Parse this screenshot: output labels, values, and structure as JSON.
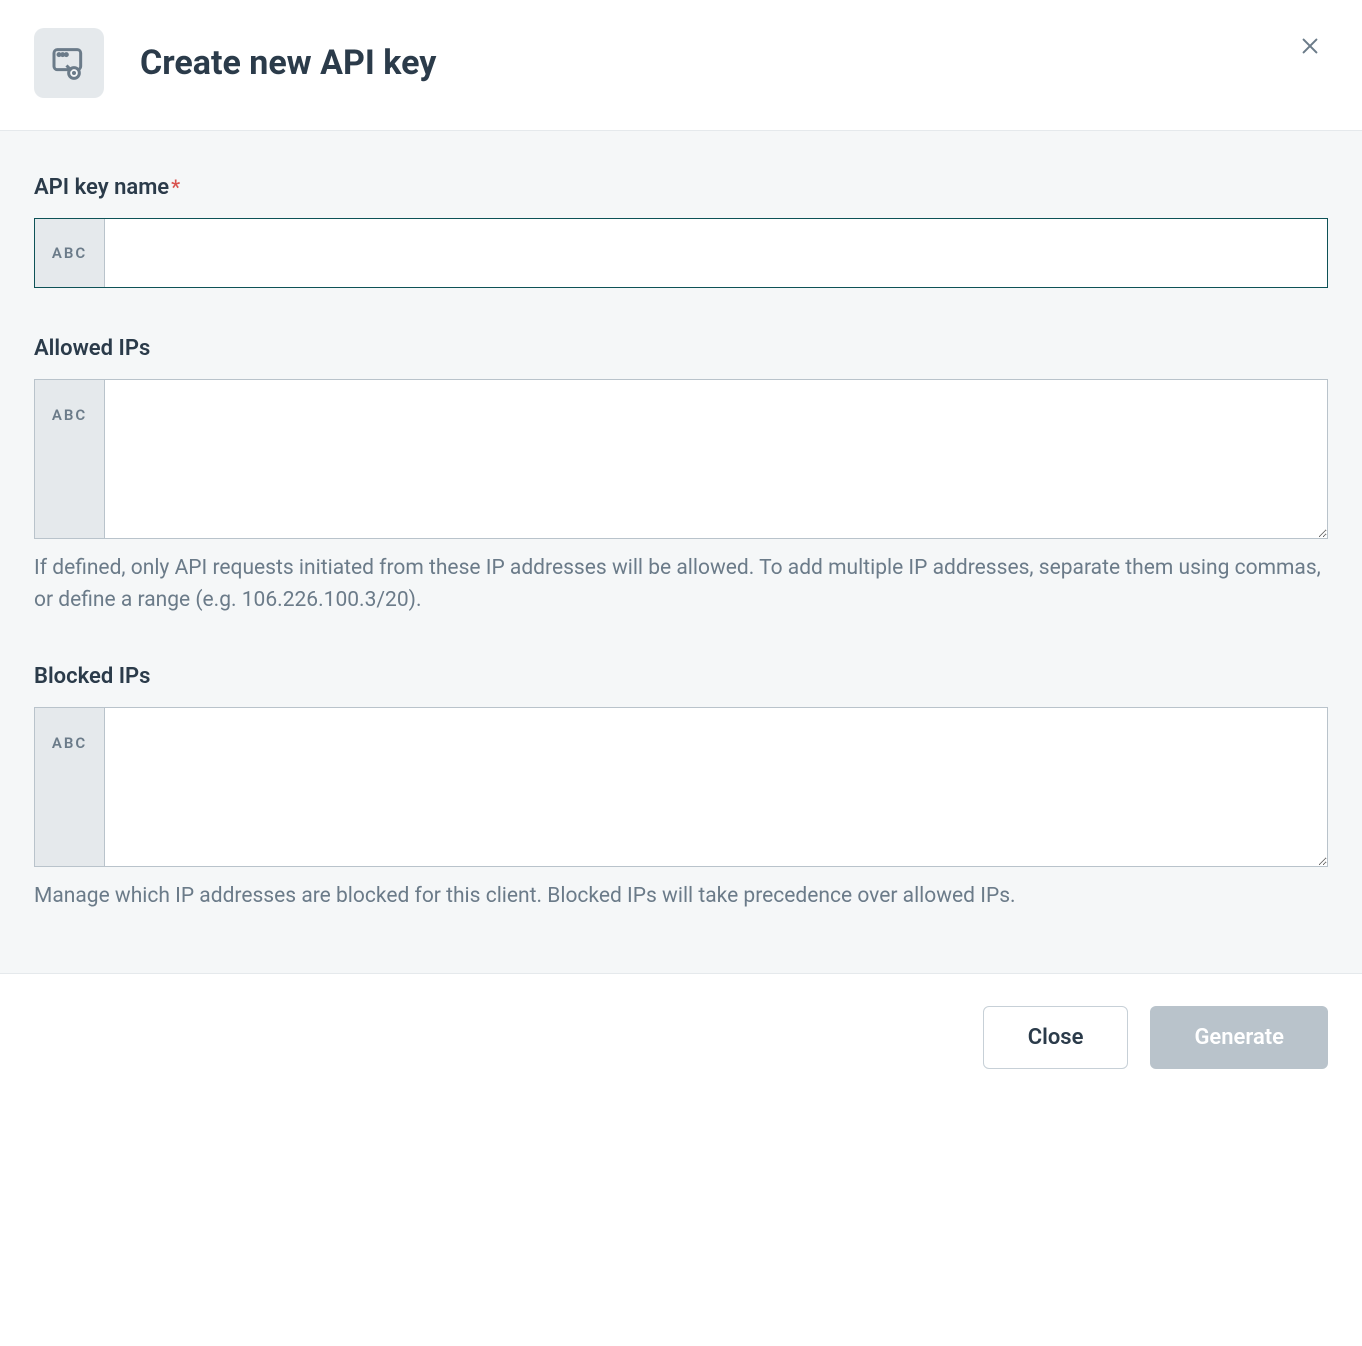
{
  "header": {
    "title": "Create new API key"
  },
  "form": {
    "api_key_name": {
      "label": "API key name",
      "required_marker": "*",
      "prefix": "ABC",
      "value": ""
    },
    "allowed_ips": {
      "label": "Allowed IPs",
      "prefix": "ABC",
      "value": "",
      "help": "If defined, only API requests initiated from these IP addresses will be allowed. To add multiple IP addresses, separate them using commas, or define a range (e.g. 106.226.100.3/20)."
    },
    "blocked_ips": {
      "label": "Blocked IPs",
      "prefix": "ABC",
      "value": "",
      "help": "Manage which IP addresses are blocked for this client. Blocked IPs will take precedence over allowed IPs."
    }
  },
  "footer": {
    "close_label": "Close",
    "generate_label": "Generate"
  }
}
